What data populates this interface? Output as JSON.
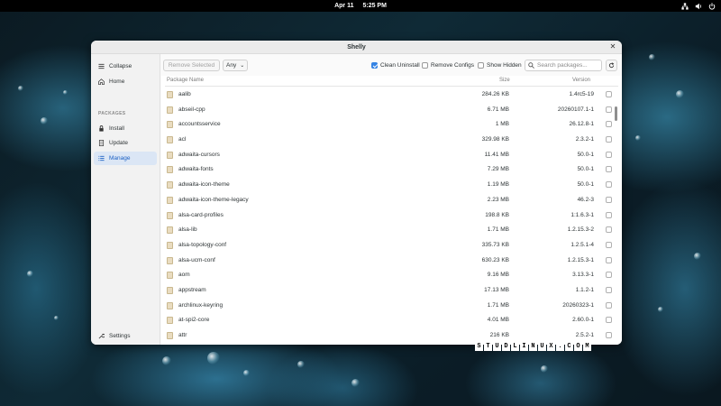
{
  "topbar": {
    "date": "Apr 11",
    "time": "5:25 PM",
    "icons": [
      "network-icon",
      "volume-icon",
      "power-icon"
    ]
  },
  "window": {
    "title": "Shelly",
    "close_icon": "close-icon"
  },
  "sidebar": {
    "collapse": "Collapse",
    "home": "Home",
    "section": "PACKAGES",
    "install": "Install",
    "update": "Update",
    "manage": "Manage",
    "settings": "Settings"
  },
  "toolbar": {
    "remove_selected": "Remove Selected",
    "filter_value": "Any",
    "clean_uninstall": "Clean Uninstall",
    "clean_uninstall_checked": true,
    "remove_configs": "Remove Configs",
    "remove_configs_checked": false,
    "show_hidden": "Show Hidden",
    "show_hidden_checked": false,
    "search_placeholder": "Search packages...",
    "refresh_icon": "refresh-icon"
  },
  "table": {
    "headers": {
      "name": "Package Name",
      "size": "Size",
      "version": "Version"
    },
    "rows": [
      {
        "name": "aalib",
        "size": "284.26 KB",
        "version": "1.4rc5-19"
      },
      {
        "name": "abseil-cpp",
        "size": "6.71 MB",
        "version": "20260107.1-1"
      },
      {
        "name": "accountsservice",
        "size": "1 MB",
        "version": "26.12.8-1"
      },
      {
        "name": "acl",
        "size": "329.98 KB",
        "version": "2.3.2-1"
      },
      {
        "name": "adwaita-cursors",
        "size": "11.41 MB",
        "version": "50.0-1"
      },
      {
        "name": "adwaita-fonts",
        "size": "7.29 MB",
        "version": "50.0-1"
      },
      {
        "name": "adwaita-icon-theme",
        "size": "1.19 MB",
        "version": "50.0-1"
      },
      {
        "name": "adwaita-icon-theme-legacy",
        "size": "2.23 MB",
        "version": "46.2-3"
      },
      {
        "name": "alsa-card-profiles",
        "size": "198.8 KB",
        "version": "1:1.6.3-1"
      },
      {
        "name": "alsa-lib",
        "size": "1.71 MB",
        "version": "1.2.15.3-2"
      },
      {
        "name": "alsa-topology-conf",
        "size": "335.73 KB",
        "version": "1.2.5.1-4"
      },
      {
        "name": "alsa-ucm-conf",
        "size": "630.23 KB",
        "version": "1.2.15.3-1"
      },
      {
        "name": "aom",
        "size": "9.16 MB",
        "version": "3.13.3-1"
      },
      {
        "name": "appstream",
        "size": "17.13 MB",
        "version": "1.1.2-1"
      },
      {
        "name": "archlinux-keyring",
        "size": "1.71 MB",
        "version": "20260323-1"
      },
      {
        "name": "at-spi2-core",
        "size": "4.01 MB",
        "version": "2.60.0-1"
      },
      {
        "name": "attr",
        "size": "216 KB",
        "version": "2.5.2-1"
      }
    ]
  },
  "watermark": [
    "S",
    "T",
    "U",
    "D",
    "L",
    "I",
    "N",
    "U",
    "X",
    ".",
    "C",
    "O",
    "M"
  ],
  "colors": {
    "accent": "#3584e4",
    "active_bg": "#dbe6f5"
  }
}
